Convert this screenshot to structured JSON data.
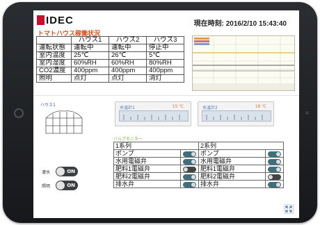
{
  "header": {
    "logo": "IDEC",
    "current_time": "現在時刻: 2016/2/10 15:43:40",
    "section_title": "トマトハウス稼働状況"
  },
  "status_table": {
    "headers": [
      "",
      "ハウス1",
      "ハウス2",
      "ハウス3"
    ],
    "rows": [
      [
        "運転状態",
        "運転中",
        "運転中",
        "停止中"
      ],
      [
        "室内温度",
        "25℃",
        "26℃",
        "5℃"
      ],
      [
        "室内湿度",
        "60%RH",
        "60%RH",
        "80%RH"
      ],
      [
        "CO2濃度",
        "400ppm",
        "400ppm",
        "400ppm"
      ],
      [
        "照明",
        "点灯",
        "点灯",
        "消灯"
      ]
    ]
  },
  "house_panel": {
    "title": "ハウス1",
    "gauges": [
      {
        "label": "水温計1",
        "value": "15 ℃"
      },
      {
        "label": "水温計2",
        "value": "18 ℃"
      }
    ],
    "valve_monitor_title": "バルブモニター",
    "valve_table": {
      "headers": [
        "1系列",
        "2系列"
      ],
      "rows": [
        [
          {
            "label": "ポンプ",
            "state": "on"
          },
          {
            "label": "ポンプ",
            "state": "on"
          }
        ],
        [
          {
            "label": "水用電磁弁",
            "state": "on"
          },
          {
            "label": "水用電磁弁",
            "state": "on"
          }
        ],
        [
          {
            "label": "肥料1電磁弁",
            "state": "off"
          },
          {
            "label": "肥料1電磁弁",
            "state": "on"
          }
        ],
        [
          {
            "label": "肥料2電磁弁",
            "state": "on"
          },
          {
            "label": "肥料2電磁弁",
            "state": "off"
          }
        ],
        [
          {
            "label": "排水弁",
            "state": "on"
          },
          {
            "label": "排水弁",
            "state": "on"
          }
        ]
      ]
    },
    "controls": [
      {
        "label": "灌水",
        "state": "ON"
      },
      {
        "label": "照明",
        "state": "ON"
      }
    ]
  },
  "colors": {
    "accent_orange": "#d9531e",
    "link_blue": "#3b5aa8",
    "valve_green": "#7ab52c",
    "brand_red": "#c8102e",
    "toggle_teal": "#3f6f7c"
  },
  "icons": {
    "expand": "expand-icon",
    "greenhouse": "greenhouse-icon"
  }
}
